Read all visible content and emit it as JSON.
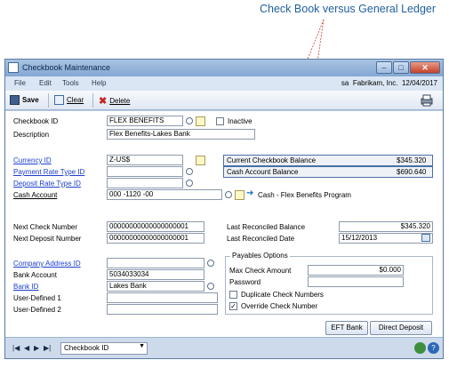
{
  "annotation": "Check Book versus General Ledger",
  "window": {
    "title": "Checkbook Maintenance"
  },
  "menu": {
    "items": [
      "File",
      "Edit",
      "Tools",
      "Help"
    ],
    "user": "sa",
    "company": "Fabrikam, Inc.",
    "date": "12/04/2017"
  },
  "toolbar": {
    "save": "Save",
    "clear": "Clear",
    "delete": "Delete"
  },
  "form": {
    "checkbook_id_label": "Checkbook ID",
    "checkbook_id": "FLEX BENEFITS",
    "inactive_label": "Inactive",
    "inactive_checked": false,
    "description_label": "Description",
    "description": "Flex Benefits-Lakes Bank",
    "currency_id_label": "Currency ID",
    "currency_id": "Z-US$",
    "payment_rate_label": "Payment Rate Type ID",
    "payment_rate": "",
    "deposit_rate_label": "Deposit Rate Type ID",
    "deposit_rate": "",
    "cash_account_label": "Cash Account",
    "cash_account": "000 -1120 -00",
    "cash_account_desc": "Cash - Flex Benefits Program",
    "current_balance_label": "Current Checkbook Balance",
    "current_balance": "$345.320",
    "cash_account_balance_label": "Cash Account Balance",
    "cash_account_balance": "$690.640",
    "next_check_label": "Next Check Number",
    "next_check": "00000000000000000001",
    "next_deposit_label": "Next Deposit Number",
    "next_deposit": "00000000000000000001",
    "last_rec_balance_label": "Last Reconciled Balance",
    "last_rec_balance": "$345.320",
    "last_rec_date_label": "Last Reconciled Date",
    "last_rec_date": "15/12/2013",
    "company_address_label": "Company Address ID",
    "company_address": "",
    "bank_account_label": "Bank Account",
    "bank_account": "5034033034",
    "bank_id_label": "Bank ID",
    "bank_id": "Lakes Bank",
    "user1_label": "User-Defined 1",
    "user1": "",
    "user2_label": "User-Defined 2",
    "user2": "",
    "payables_title": "Payables Options",
    "max_check_label": "Max Check Amount",
    "max_check": "$0.000",
    "password_label": "Password",
    "password": "",
    "dup_checks_label": "Duplicate Check Numbers",
    "dup_checks_checked": false,
    "override_label": "Override Check Number",
    "override_checked": true
  },
  "buttons": {
    "eft_bank": "EFT Bank",
    "direct_deposit": "Direct Deposit"
  },
  "statusbar": {
    "sort_by": "Checkbook ID"
  },
  "colors": {
    "annotation": "#1f5f9e",
    "link": "#1b3fcf",
    "arrow": "#c0392b",
    "highlight": "#4a6fa5"
  }
}
